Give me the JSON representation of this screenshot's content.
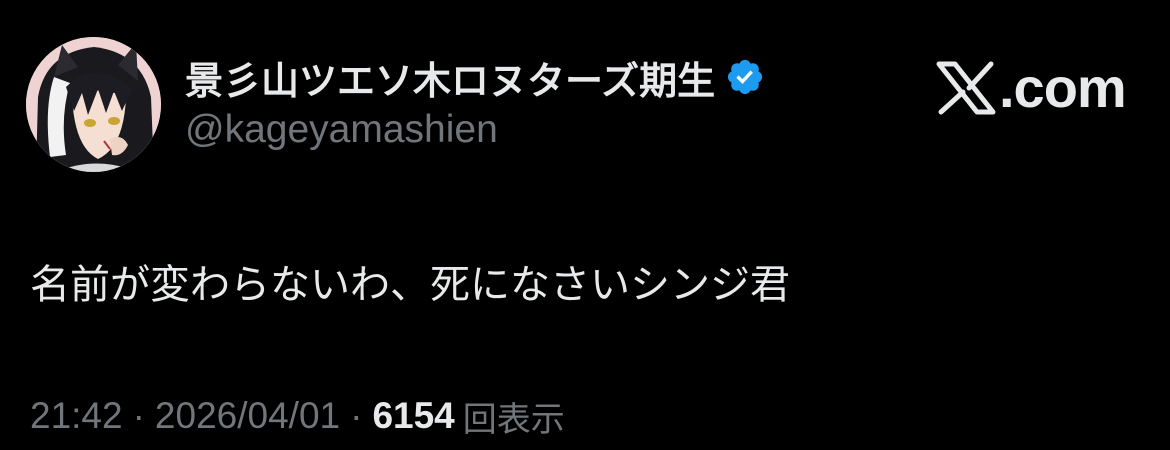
{
  "author": {
    "display_name": "景彡山ツエソ木ロヌターズ期生",
    "handle": "@kageyamashien",
    "verified": true,
    "avatar_icon": "anime-character-avatar-icon"
  },
  "brand": {
    "logo_icon": "x-logo-icon",
    "text": ".com"
  },
  "tweet": {
    "text": "名前が変わらないわ、死になさいシンジ君"
  },
  "meta": {
    "time": "21:42",
    "separator": "·",
    "date": "2026/04/01",
    "views_count": "6154",
    "views_label": "回表示"
  },
  "colors": {
    "background": "#000000",
    "primary_text": "#e7e9ea",
    "secondary_text": "#71767b",
    "verified_badge": "#1d9bf0"
  }
}
